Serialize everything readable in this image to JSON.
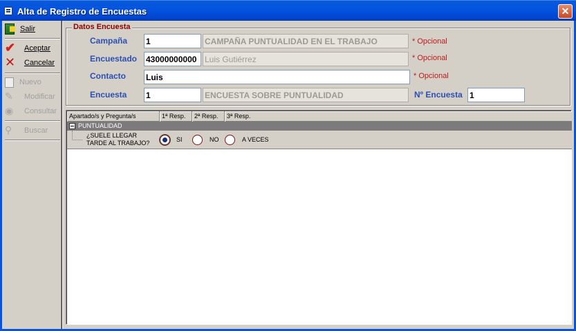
{
  "window": {
    "title": "Alta de Registro de Encuestas",
    "close_label": "✕"
  },
  "toolbar": {
    "salir": "Salir",
    "aceptar": "Aceptar",
    "cancelar": "Cancelar",
    "nuevo": "Nuevo",
    "modificar": "Modificar",
    "consultar": "Consultar",
    "buscar": "Buscar"
  },
  "form": {
    "group_title": "Datos Encuesta",
    "campana": {
      "label": "Campaña",
      "code": "1",
      "description": "CAMPAÑA PUNTUALIDAD EN EL TRABAJO",
      "note": "* Opcional"
    },
    "encuestado": {
      "label": "Encuestado",
      "code": "43000000000",
      "description": "Luis Gutiérrez",
      "note": "* Opcional"
    },
    "contacto": {
      "label": "Contacto",
      "value": "Luis",
      "note": "* Opcional"
    },
    "encuesta": {
      "label": "Encuesta",
      "code": "1",
      "description": "ENCUESTA SOBRE PUNTUALIDAD"
    },
    "n_encuesta": {
      "label": "Nº Encuesta",
      "value": "1"
    }
  },
  "grid": {
    "columns": [
      "Apartado/s y Pregunta/s",
      "1ª Resp.",
      "2ª Resp.",
      "3ª Resp."
    ],
    "section": "PUNTUALIDAD",
    "question": {
      "line1": "¿SUELE LLEGAR",
      "line2": "TARDE AL TRABAJO?"
    },
    "options": [
      {
        "label": "SI",
        "selected": true
      },
      {
        "label": "NO",
        "selected": false
      },
      {
        "label": "A VECES",
        "selected": false
      }
    ]
  }
}
